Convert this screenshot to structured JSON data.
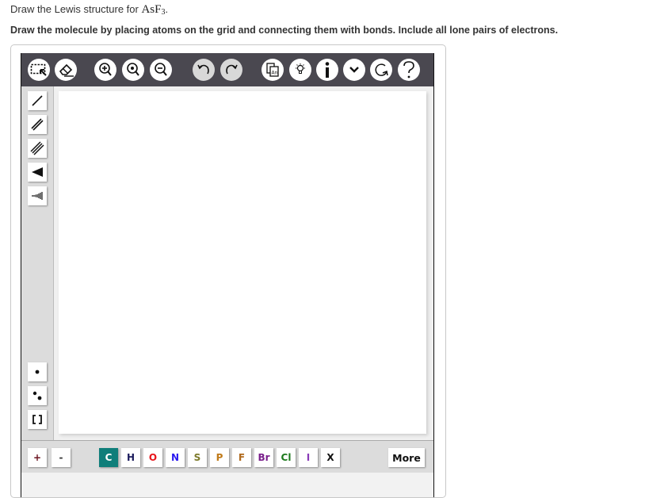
{
  "question": {
    "prefix": "Draw the Lewis structure for ",
    "formula_main": "AsF",
    "formula_sub": "3",
    "suffix": ".",
    "instruction": "Draw the molecule by placing atoms on the grid and connecting them with bonds. Include all lone pairs of electrons."
  },
  "toolbar": {
    "buttons": [
      {
        "name": "select-tool",
        "icon": "marquee-select-icon"
      },
      {
        "name": "eraser-tool",
        "icon": "eraser-icon"
      },
      {
        "name": "zoom-in",
        "icon": "zoom-in-icon"
      },
      {
        "name": "zoom-reset",
        "icon": "zoom-reset-icon"
      },
      {
        "name": "zoom-out",
        "icon": "zoom-out-icon"
      },
      {
        "name": "undo",
        "icon": "undo-icon"
      },
      {
        "name": "redo",
        "icon": "redo-icon"
      },
      {
        "name": "templates",
        "icon": "template-copy-icon"
      },
      {
        "name": "hint",
        "icon": "lightbulb-icon"
      },
      {
        "name": "info",
        "icon": "info-icon"
      },
      {
        "name": "expand",
        "icon": "chevron-down-icon"
      },
      {
        "name": "reset",
        "icon": "refresh-icon"
      },
      {
        "name": "help",
        "icon": "question-icon"
      }
    ]
  },
  "left_tools": [
    {
      "name": "single-bond",
      "icon": "single-bond-icon"
    },
    {
      "name": "double-bond",
      "icon": "double-bond-icon"
    },
    {
      "name": "triple-bond",
      "icon": "triple-bond-icon"
    },
    {
      "name": "wedge-bond",
      "icon": "wedge-bond-icon"
    },
    {
      "name": "hash-bond",
      "icon": "hash-bond-icon"
    },
    {
      "name": "radical",
      "icon": "single-dot-icon"
    },
    {
      "name": "lone-pair",
      "icon": "lone-pair-icon"
    },
    {
      "name": "brackets",
      "icon": "brackets-icon"
    }
  ],
  "bottom": {
    "charge_plus": "+",
    "charge_minus": "-",
    "elements": [
      {
        "symbol": "C",
        "color": "#ffffff",
        "active": true
      },
      {
        "symbol": "H",
        "color": "#1b1b5c"
      },
      {
        "symbol": "O",
        "color": "#e8141a"
      },
      {
        "symbol": "N",
        "color": "#2a19f0"
      },
      {
        "symbol": "S",
        "color": "#7d7a2a"
      },
      {
        "symbol": "P",
        "color": "#c07a19"
      },
      {
        "symbol": "F",
        "color": "#b06a1d"
      },
      {
        "symbol": "Br",
        "color": "#7a1f8c"
      },
      {
        "symbol": "Cl",
        "color": "#1d7a1d"
      },
      {
        "symbol": "I",
        "color": "#8a3bb8"
      },
      {
        "symbol": "X",
        "color": "#111111"
      }
    ],
    "more_label": "More"
  },
  "colors": {
    "toolbar_bg": "#4a4850",
    "active_element": "#0f7e7a"
  }
}
